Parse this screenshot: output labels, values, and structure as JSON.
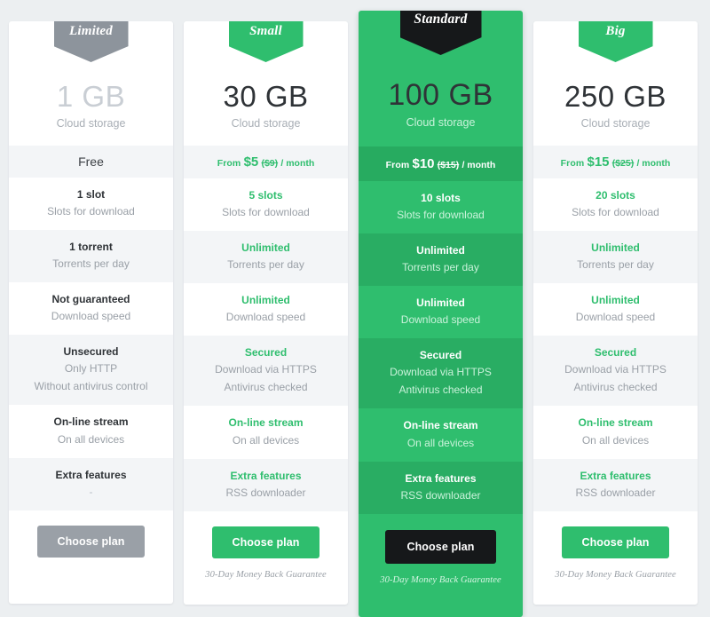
{
  "colors": {
    "page_background": "#eceff1",
    "accent_green": "#2fbe6e",
    "accent_green_dark": "#27ab60",
    "featured_row_alt": "#29ad63",
    "grey_badge": "#8d949c",
    "dark_badge": "#16181a",
    "row_alt": "#f3f5f7",
    "text_dark": "#2f3337",
    "text_muted": "#9aa0a7",
    "storage_muted": "#c9ced4"
  },
  "plans": [
    {
      "id": "limited",
      "ribbon_label": "Limited",
      "ribbon_style": "grey",
      "featured": false,
      "storage_size": "1 GB",
      "storage_caption": "Cloud storage",
      "price": {
        "is_free": true,
        "free_label": "Free",
        "from_label": "",
        "amount": "",
        "old_amount": "",
        "period": ""
      },
      "features": [
        {
          "value": "1 slot",
          "desc": "Slots for download",
          "desc2": ""
        },
        {
          "value": "1 torrent",
          "desc": "Torrents per day",
          "desc2": ""
        },
        {
          "value": "Not guaranteed",
          "desc": "Download speed",
          "desc2": ""
        },
        {
          "value": "Unsecured",
          "desc": "Only HTTP",
          "desc2": "Without antivirus control"
        },
        {
          "value": "On-line stream",
          "desc": "On all devices",
          "desc2": ""
        },
        {
          "value": "Extra features",
          "desc": "-",
          "desc2": ""
        }
      ],
      "cta_label": "Choose plan",
      "cta_style": "grey",
      "guarantee": "",
      "guarantee_visible": false
    },
    {
      "id": "small",
      "ribbon_label": "Small",
      "ribbon_style": "green",
      "featured": false,
      "storage_size": "30 GB",
      "storage_caption": "Cloud storage",
      "price": {
        "is_free": false,
        "free_label": "",
        "from_label": "From",
        "amount": "$5",
        "old_amount": "($9)",
        "period": "/ month"
      },
      "features": [
        {
          "value": "5 slots",
          "desc": "Slots for download",
          "desc2": ""
        },
        {
          "value": "Unlimited",
          "desc": "Torrents per day",
          "desc2": ""
        },
        {
          "value": "Unlimited",
          "desc": "Download speed",
          "desc2": ""
        },
        {
          "value": "Secured",
          "desc": "Download via HTTPS",
          "desc2": "Antivirus checked"
        },
        {
          "value": "On-line stream",
          "desc": "On all devices",
          "desc2": ""
        },
        {
          "value": "Extra features",
          "desc": "RSS downloader",
          "desc2": ""
        }
      ],
      "cta_label": "Choose plan",
      "cta_style": "green",
      "guarantee": "30-Day Money Back Guarantee",
      "guarantee_visible": true
    },
    {
      "id": "standard",
      "ribbon_label": "Standard",
      "ribbon_style": "dark",
      "featured": true,
      "storage_size": "100 GB",
      "storage_caption": "Cloud storage",
      "price": {
        "is_free": false,
        "free_label": "",
        "from_label": "From",
        "amount": "$10",
        "old_amount": "($15)",
        "period": "/ month"
      },
      "features": [
        {
          "value": "10 slots",
          "desc": "Slots for download",
          "desc2": ""
        },
        {
          "value": "Unlimited",
          "desc": "Torrents per day",
          "desc2": ""
        },
        {
          "value": "Unlimited",
          "desc": "Download speed",
          "desc2": ""
        },
        {
          "value": "Secured",
          "desc": "Download via HTTPS",
          "desc2": "Antivirus checked"
        },
        {
          "value": "On-line stream",
          "desc": "On all devices",
          "desc2": ""
        },
        {
          "value": "Extra features",
          "desc": "RSS downloader",
          "desc2": ""
        }
      ],
      "cta_label": "Choose plan",
      "cta_style": "dark",
      "guarantee": "30-Day Money Back Guarantee",
      "guarantee_visible": true
    },
    {
      "id": "big",
      "ribbon_label": "Big",
      "ribbon_style": "green",
      "featured": false,
      "storage_size": "250 GB",
      "storage_caption": "Cloud storage",
      "price": {
        "is_free": false,
        "free_label": "",
        "from_label": "From",
        "amount": "$15",
        "old_amount": "($25)",
        "period": "/ month"
      },
      "features": [
        {
          "value": "20 slots",
          "desc": "Slots for download",
          "desc2": ""
        },
        {
          "value": "Unlimited",
          "desc": "Torrents per day",
          "desc2": ""
        },
        {
          "value": "Unlimited",
          "desc": "Download speed",
          "desc2": ""
        },
        {
          "value": "Secured",
          "desc": "Download via HTTPS",
          "desc2": "Antivirus checked"
        },
        {
          "value": "On-line stream",
          "desc": "On all devices",
          "desc2": ""
        },
        {
          "value": "Extra features",
          "desc": "RSS downloader",
          "desc2": ""
        }
      ],
      "cta_label": "Choose plan",
      "cta_style": "green",
      "guarantee": "30-Day Money Back Guarantee",
      "guarantee_visible": true
    }
  ]
}
